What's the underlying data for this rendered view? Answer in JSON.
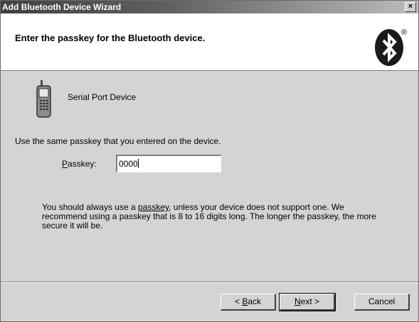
{
  "window": {
    "title": "Add Bluetooth Device Wizard",
    "close_glyph": "×"
  },
  "header": {
    "heading": "Enter the passkey for the Bluetooth device.",
    "logo_registered": "®"
  },
  "device": {
    "icon": "mobile-phone-icon",
    "name": "Serial Port Device"
  },
  "form": {
    "instruction": "Use the same passkey that you entered on the device.",
    "passkey_mnemonic": "P",
    "passkey_label_rest": "asskey:",
    "passkey_value": "0000"
  },
  "info": {
    "before_link": "You should always use a ",
    "link": "passkey",
    "after_link": ", unless your device does not support one. We recommend using a passkey that is 8 to 16 digits long. The longer the passkey, the more secure it will be."
  },
  "buttons": {
    "back_prefix": "< ",
    "back_mnemonic": "B",
    "back_rest": "ack",
    "next_mnemonic": "N",
    "next_rest": "ext >",
    "cancel": "Cancel"
  },
  "colors": {
    "titlebar_dark": "#404040",
    "dialog_bg": "#d4d4d4",
    "header_bg": "#ffffff"
  }
}
